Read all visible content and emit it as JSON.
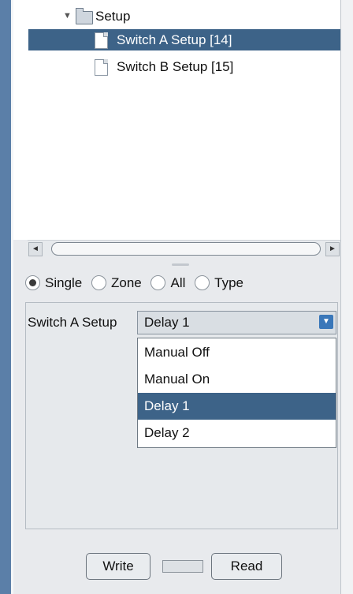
{
  "tree": {
    "folder_label": "Setup",
    "items": [
      {
        "label": "Switch A Setup [14]",
        "selected": true
      },
      {
        "label": "Switch B Setup [15]",
        "selected": false
      }
    ]
  },
  "scrollbar": {
    "left_arrow": "◄",
    "right_arrow": "►"
  },
  "radio_group": {
    "options": [
      {
        "label": "Single",
        "checked": true
      },
      {
        "label": "Zone",
        "checked": false
      },
      {
        "label": "All",
        "checked": false
      },
      {
        "label": "Type",
        "checked": false
      }
    ]
  },
  "setting": {
    "label": "Switch A Setup",
    "selected_value": "Delay 1",
    "options": [
      "Manual Off",
      "Manual On",
      "Delay 1",
      "Delay 2"
    ]
  },
  "buttons": {
    "write": "Write",
    "read": "Read"
  },
  "colors": {
    "selection": "#3d6388",
    "accent": "#3a77b9"
  }
}
